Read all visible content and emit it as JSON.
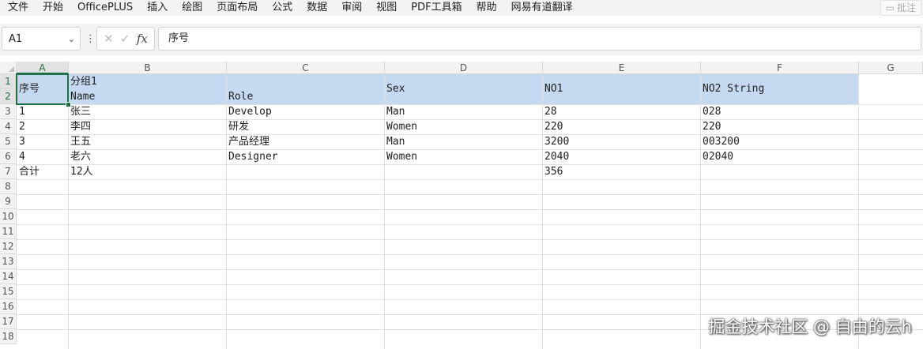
{
  "menu": {
    "items": [
      "文件",
      "开始",
      "OfficePLUS",
      "插入",
      "绘图",
      "页面布局",
      "公式",
      "数据",
      "审阅",
      "视图",
      "PDF工具箱",
      "帮助",
      "网易有道翻译"
    ],
    "comment_label": "批注"
  },
  "formula_bar": {
    "name_box": "A1",
    "separator": "⋮",
    "cancel_icon": "close-icon",
    "confirm_icon": "check-icon",
    "fx_label": "fx",
    "content": "序号"
  },
  "grid": {
    "columns": [
      "A",
      "B",
      "C",
      "D",
      "E",
      "F",
      "G"
    ],
    "rows": [
      "1",
      "2",
      "3",
      "4",
      "5",
      "6",
      "7",
      "8",
      "9",
      "10",
      "11",
      "12",
      "13",
      "14",
      "15",
      "16",
      "17",
      "18"
    ],
    "active_cell": "A1",
    "header_fill_color": "#c5d9f1",
    "selection_color": "#1e7145",
    "cells": {
      "a1": "序号",
      "b1": "分组1",
      "b2": "Name",
      "c2": "Role",
      "d1": "Sex",
      "e1": "NO1",
      "f1": "NO2 String",
      "a3": "1",
      "b3": "张三",
      "c3": "Develop",
      "d3": "Man",
      "e3": "28",
      "f3": "028",
      "a4": "2",
      "b4": "李四",
      "c4": "研发",
      "d4": "Women",
      "e4": "220",
      "f4": "220",
      "a5": "3",
      "b5": "王五",
      "c5": "产品经理",
      "d5": "Man",
      "e5": "3200",
      "f5": "003200",
      "a6": "4",
      "b6": "老六",
      "c6": "Designer",
      "d6": "Women",
      "e6": "2040",
      "f6": "02040",
      "a7": "合计",
      "b7": "12人",
      "e7": "356"
    }
  },
  "watermark": "掘金技术社区 @ 自由的云h"
}
